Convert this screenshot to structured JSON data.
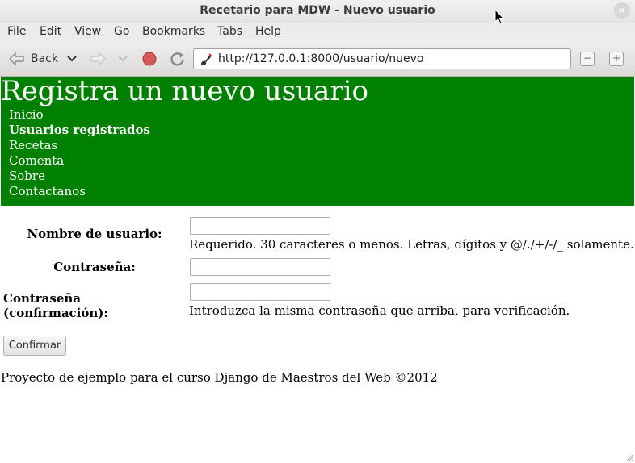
{
  "window": {
    "title": "Recetario para MDW - Nuevo usuario"
  },
  "menu": [
    "File",
    "Edit",
    "View",
    "Go",
    "Bookmarks",
    "Tabs",
    "Help"
  ],
  "toolbar": {
    "back_label": "Back",
    "url": "http://127.0.0.1:8000/usuario/nuevo"
  },
  "page": {
    "title": "Registra un nuevo usuario",
    "nav": [
      "Inicio",
      "Usuarios registrados",
      "Recetas",
      "Comenta",
      "Sobre",
      "Contactanos"
    ],
    "nav_active": "Usuarios registrados",
    "header_color": "#008000",
    "form": {
      "username_label": "Nombre de usuario:",
      "username_value": "",
      "username_help": "Requerido. 30 caracteres o menos. Letras, dígitos y @/./+/-/_ solamente.",
      "password_label": "Contraseña:",
      "password_value": "",
      "password2_label": "Contraseña (confirmación):",
      "password2_value": "",
      "password2_help": "Introduzca la misma contraseña que arriba, para verificación.",
      "submit_label": "Confirmar"
    },
    "footer": "Proyecto de ejemplo para el curso Django de Maestros del Web ©2012"
  }
}
